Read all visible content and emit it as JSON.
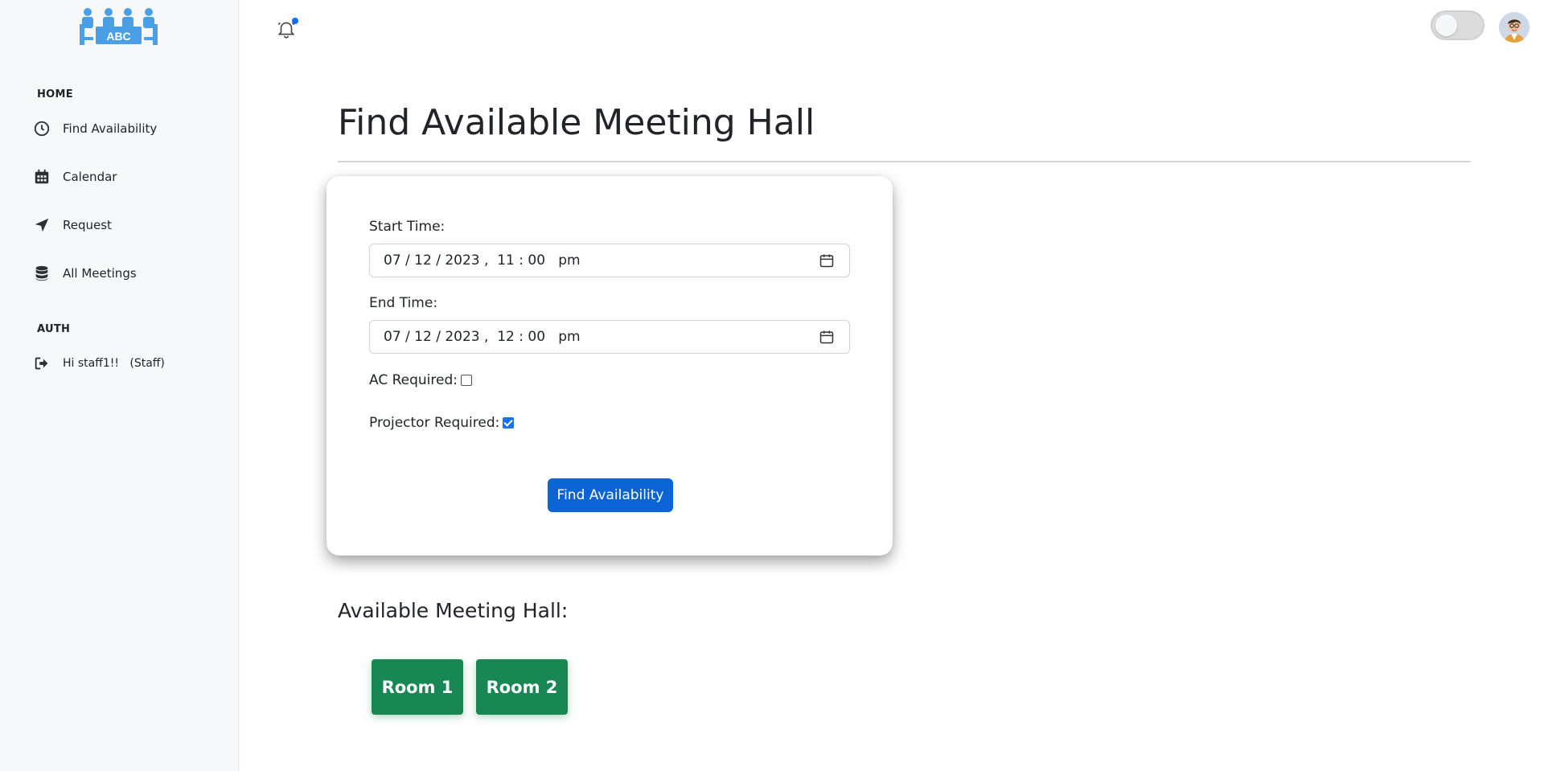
{
  "logo": {
    "text": "ABC"
  },
  "sidebar": {
    "home_label": "HOME",
    "auth_label": "AUTH",
    "items": [
      {
        "label": "Find Availability",
        "icon": "clock-icon"
      },
      {
        "label": "Calendar",
        "icon": "calendar-icon"
      },
      {
        "label": "Request",
        "icon": "paper-plane-icon"
      },
      {
        "label": "All Meetings",
        "icon": "database-icon"
      }
    ],
    "auth_item": {
      "label": "Hi staff1!!   (Staff)",
      "icon": "sign-out-icon"
    }
  },
  "topbar": {
    "notification_dot_color": "#0d6efd",
    "theme_toggle_on": false
  },
  "main": {
    "title": "Find Available Meeting Hall",
    "form": {
      "start_label": "Start Time:",
      "start_value": "07 / 12 / 2023 ,  11 : 00   pm",
      "end_label": "End Time:",
      "end_value": "07 / 12 / 2023 ,  12 : 00   pm",
      "ac_label": "AC Required:",
      "ac_checked": false,
      "projector_label": "Projector Required:",
      "projector_checked": true,
      "submit_label": "Find Availability"
    },
    "results": {
      "title": "Available Meeting Hall:",
      "rooms": [
        "Room 1",
        "Room 2"
      ]
    }
  },
  "colors": {
    "primary": "#0b63d6",
    "success": "#198754",
    "logo_blue": "#4a9fe6"
  }
}
